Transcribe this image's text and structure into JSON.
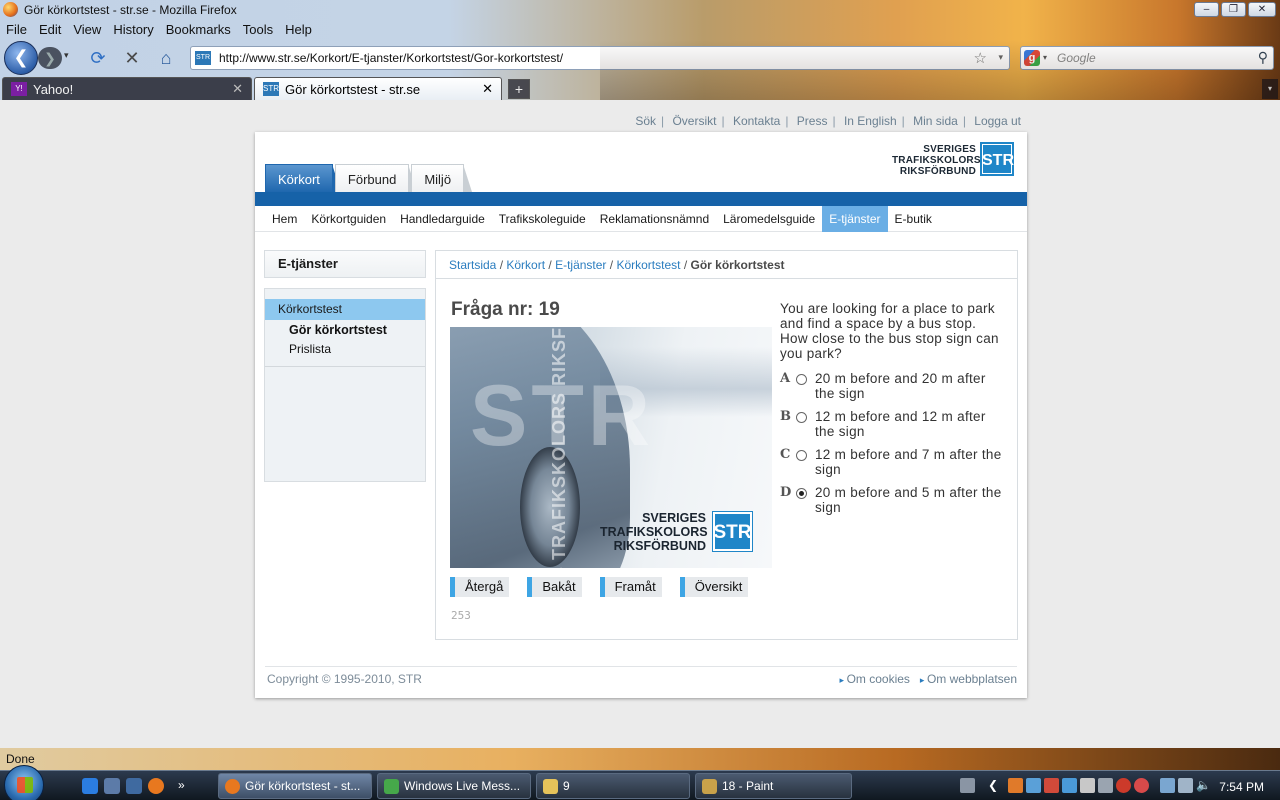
{
  "browser": {
    "window_title": "Gör körkortstest - str.se - Mozilla Firefox",
    "window_buttons": [
      "–",
      "❐",
      "✕"
    ],
    "menu": [
      "File",
      "Edit",
      "View",
      "History",
      "Bookmarks",
      "Tools",
      "Help"
    ],
    "url": "http://www.str.se/Korkort/E-tjanster/Korkortstest/Gor-korkortstest/",
    "site_icon_text": "STR",
    "search_placeholder": "Google",
    "tabs": [
      {
        "label": "Yahoo!",
        "active": false
      },
      {
        "label": "Gör körkortstest - str.se",
        "active": true
      }
    ],
    "status": "Done"
  },
  "page": {
    "utility_links": [
      "Sök",
      "Översikt",
      "Kontakta",
      "Press",
      "In English",
      "Min sida",
      "Logga ut"
    ],
    "top_tabs": [
      "Körkort",
      "Förbund",
      "Miljö"
    ],
    "logo_lines": [
      "SVERIGES",
      "TRAFIKSKOLORS",
      "RIKSFÖRBUND"
    ],
    "logo_mark": "STR",
    "sub_nav": [
      "Hem",
      "Körkortguiden",
      "Handledarguide",
      "Trafikskoleguide",
      "Reklamationsnämnd",
      "Läromedelsguide",
      "E-tjänster",
      "E-butik"
    ],
    "sub_nav_active": "E-tjänster",
    "left_heading": "E-tjänster",
    "left_menu": {
      "parent": "Körkortstest",
      "children": [
        "Gör körkortstest",
        "Prislista"
      ]
    },
    "breadcrumb": [
      "Startsida",
      "Körkort",
      "E-tjänster",
      "Körkortstest"
    ],
    "breadcrumb_current": "Gör körkortstest",
    "question_title": "Fråga nr: 19",
    "question_image": {
      "watermark_vertical": "VERIGES TRAFIKSKOLORS RIKSFÖRBUND",
      "watermark_big": "STR",
      "logo_lines": [
        "SVERIGES",
        "TRAFIKSKOLORS",
        "RIKSFÖRBUND"
      ],
      "logo_mark": "STR"
    },
    "question_text": "You are looking for a place to park and find a space by a bus stop. How close to the bus stop sign can you park?",
    "options": [
      {
        "letter": "A",
        "text": "20 m before and 20 m after the sign",
        "selected": false
      },
      {
        "letter": "B",
        "text": "12 m before and 12 m after the sign",
        "selected": false
      },
      {
        "letter": "C",
        "text": "12 m before and 7 m after the sign",
        "selected": false
      },
      {
        "letter": "D",
        "text": "20 m before and 5 m after the sign",
        "selected": true
      }
    ],
    "buttons": [
      "Återgå",
      "Bakåt",
      "Framåt",
      "Översikt"
    ],
    "counter": "253",
    "footer": {
      "copyright": "Copyright © 1995-2010, STR",
      "links": [
        "Om cookies",
        "Om webbplatsen"
      ]
    }
  },
  "taskbar": {
    "windows": [
      {
        "label": "Gör körkortstest - st...",
        "active": true
      },
      {
        "label": "Windows Live Mess...",
        "active": false
      },
      {
        "label": "9",
        "active": false
      },
      {
        "label": "18 - Paint",
        "active": false
      }
    ],
    "clock": "7:54 PM"
  },
  "colors": {
    "brand_blue": "#1662a8",
    "link_blue": "#2b7dbf",
    "active_subnav": "#6aaee5",
    "left_menu_active": "#8dc8ef",
    "button_accent": "#3ea5e4"
  }
}
